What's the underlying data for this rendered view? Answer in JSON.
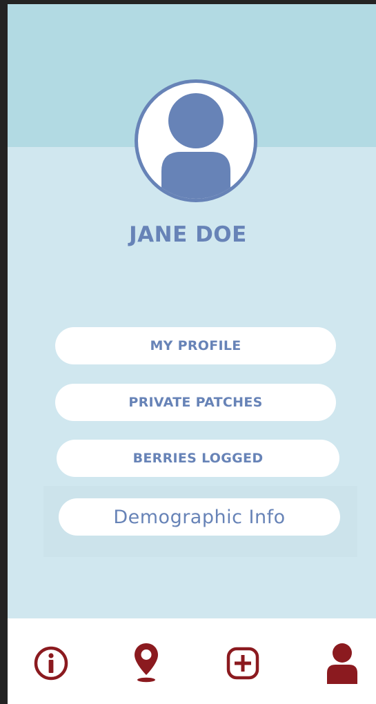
{
  "profile": {
    "name": "JANE DOE"
  },
  "menu": {
    "my_profile": "MY PROFILE",
    "private_patches": "PRIVATE PATCHES",
    "berries_logged": "BERRIES LOGGED",
    "demographic_info": "Demographic Info"
  },
  "tabbar": {
    "items": [
      {
        "icon": "info-icon"
      },
      {
        "icon": "map-pin-icon"
      },
      {
        "icon": "add-icon"
      },
      {
        "icon": "user-icon"
      }
    ]
  },
  "colors": {
    "background": "#d0e7ef",
    "header_band": "#b2dae3",
    "accent_blue": "#6783b7",
    "accent_red": "#8b1a1f",
    "button_bg": "#ffffff"
  }
}
